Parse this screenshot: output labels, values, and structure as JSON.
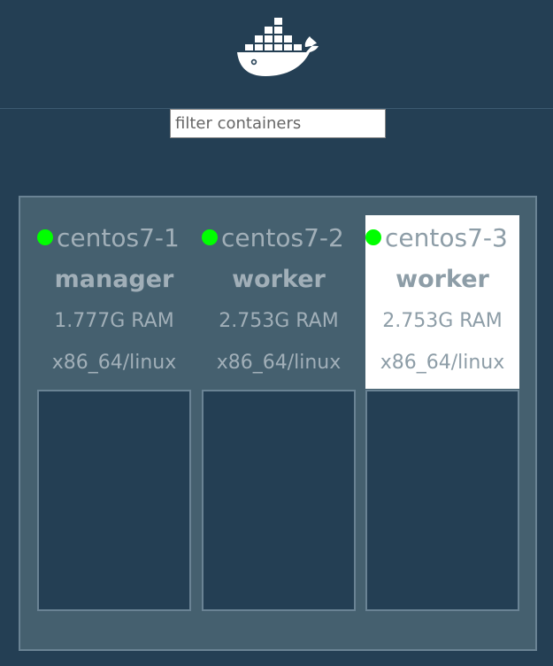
{
  "header": {
    "logo_icon": "docker-whale-icon"
  },
  "filter": {
    "placeholder": "filter containers",
    "value": ""
  },
  "colors": {
    "background": "#243f54",
    "board": "#45606f",
    "status_active": "#00ff00",
    "selected_bg": "#ffffff"
  },
  "nodes": [
    {
      "name": "centos7-1",
      "role": "manager",
      "ram": "1.777G RAM",
      "os": "x86_64/linux",
      "status": "active",
      "selected": false
    },
    {
      "name": "centos7-2",
      "role": "worker",
      "ram": "2.753G RAM",
      "os": "x86_64/linux",
      "status": "active",
      "selected": false
    },
    {
      "name": "centos7-3",
      "role": "worker",
      "ram": "2.753G RAM",
      "os": "x86_64/linux",
      "status": "active",
      "selected": true
    }
  ]
}
